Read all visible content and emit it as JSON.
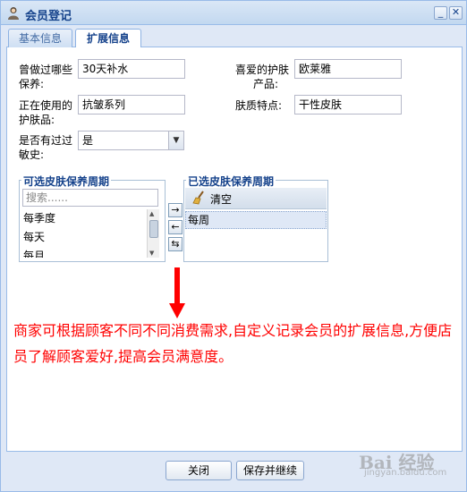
{
  "window": {
    "title": "会员登记"
  },
  "tabs": [
    {
      "label": "基本信息",
      "active": false
    },
    {
      "label": "扩展信息",
      "active": true
    }
  ],
  "form": {
    "tried_products": {
      "label_line1": "曾做过哪些",
      "label_line2": "保养:",
      "value": "30天补水"
    },
    "favorite_products": {
      "label_line1": "喜爱的护肤",
      "label_line2": "产品:",
      "value": "欧莱雅"
    },
    "current_products": {
      "label_line1": "正在使用的",
      "label_line2": "护肤品:",
      "value": "抗皱系列"
    },
    "skin_type": {
      "label": "肤质特点:",
      "value": "干性皮肤"
    },
    "allergy": {
      "label_line1": "是否有过过",
      "label_line2": "敏史:",
      "value": "是"
    }
  },
  "available": {
    "legend": "可选皮肤保养周期",
    "search_placeholder": "搜索......",
    "items": [
      "每季度",
      "每天",
      "每月"
    ]
  },
  "selected": {
    "legend": "已选皮肤保养周期",
    "clear_label": "清空",
    "items": [
      "每周"
    ]
  },
  "move_buttons": {
    "add": "→",
    "remove": "←",
    "swap": "⇆"
  },
  "annotation": "商家可根据顾客不同不同消费需求,自定义记录会员的扩展信息,方便店员了解顾客爱好,提高会员满意度。",
  "footer": {
    "close_label": "关闭",
    "save_continue_label": "保存并继续"
  },
  "watermark": {
    "brand": "Bai 经验",
    "url": "jingyan.baidu.com"
  },
  "colors": {
    "title": "#15428b",
    "annotation": "#ff0000",
    "frame": "#99bbe8"
  }
}
